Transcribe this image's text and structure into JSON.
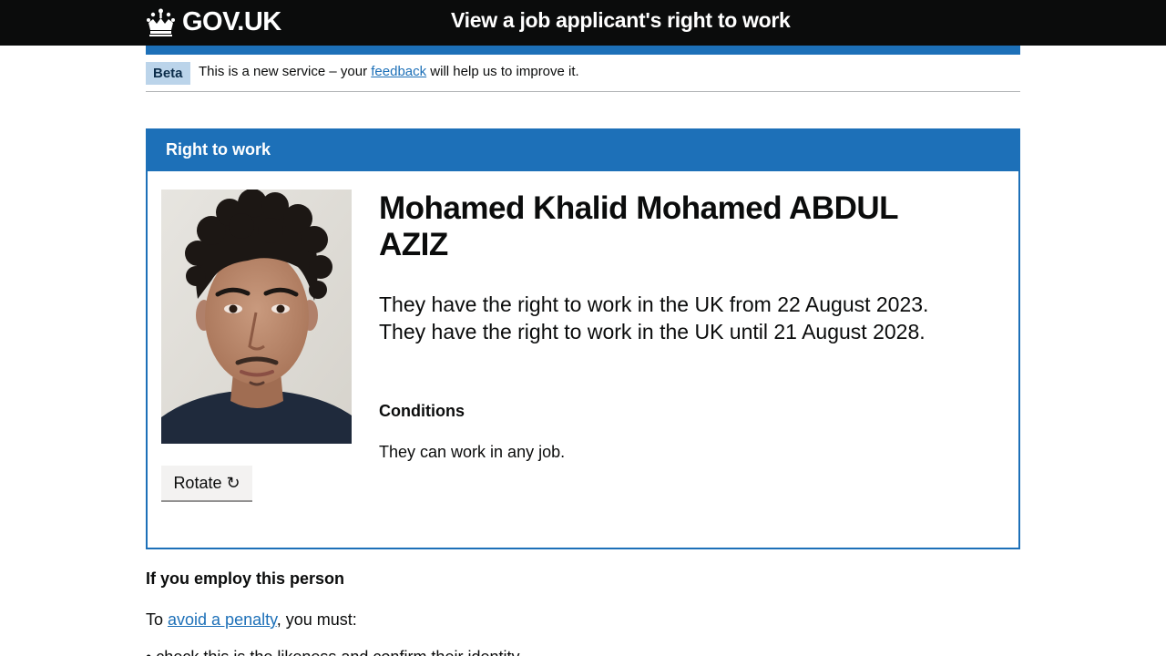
{
  "header": {
    "logo_text": "GOV.UK",
    "service_name": "View a job applicant's right to work"
  },
  "phase_banner": {
    "tag": "Beta",
    "text_before": "This is a new service – your ",
    "link_text": "feedback",
    "text_after": " will help us to improve it."
  },
  "panel": {
    "title": "Right to work",
    "rotate_label": "Rotate ↻",
    "name": "Mohamed Khalid Mohamed ABDUL AZIZ",
    "status": "They have the right to work in the UK from 22 August 2023. They have the right to work in the UK until 21 August 2028.",
    "conditions_heading": "Conditions",
    "conditions_text": "They can work in any job."
  },
  "employ": {
    "heading": "If you employ this person",
    "text_before": "To ",
    "link_text": "avoid a penalty",
    "text_after": ", you must:",
    "first_item": "• check this is the likeness and confirm their identity"
  },
  "colors": {
    "header_bg": "#0b0c0c",
    "accent_blue": "#1d70b8",
    "link_blue": "#1d70b8",
    "beta_tag_bg": "#bbd4ea"
  }
}
